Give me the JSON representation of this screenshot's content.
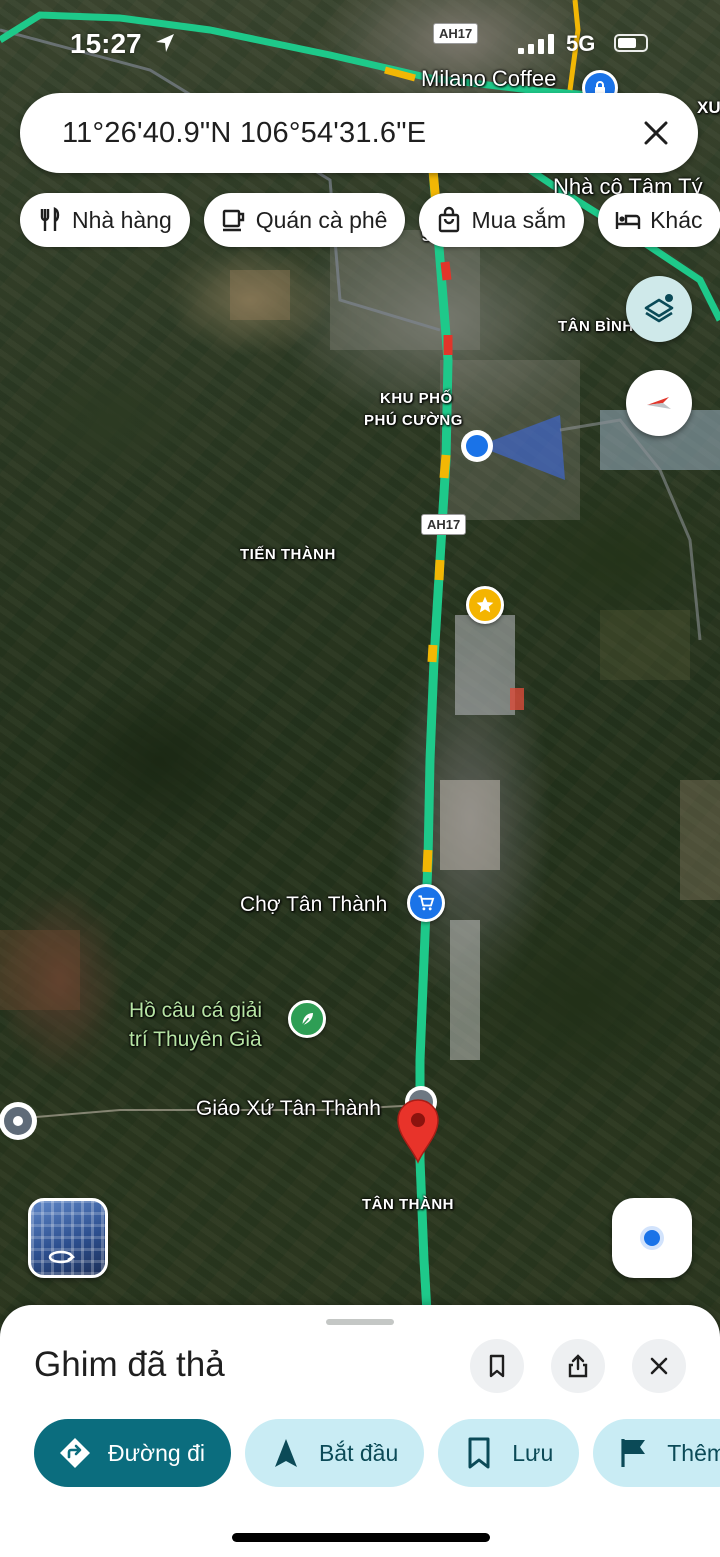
{
  "status_bar": {
    "time": "15:27",
    "network": "5G"
  },
  "search": {
    "query": "11°26'40.9\"N 106°54'31.6\"E"
  },
  "chips": [
    {
      "label": "Nhà hàng",
      "icon": "restaurant-icon"
    },
    {
      "label": "Quán cà phê",
      "icon": "coffee-icon"
    },
    {
      "label": "Mua sắm",
      "icon": "shopping-bag-icon"
    },
    {
      "label": "Khác",
      "icon": "hotel-bed-icon"
    }
  ],
  "map": {
    "labels": {
      "milano": "Milano Coffee",
      "xu": "XU",
      "nha_co": "Nhà cô Tâm Tý",
      "tan_binh": "TÂN BÌNH",
      "khu_pho_line1": "KHU PHỐ",
      "khu_pho_line2": "PHÚ CƯỜNG",
      "tien_thanh": "TIẾN THÀNH",
      "cho_tan_thanh": "Chợ Tân Thành",
      "ho_cau_line1": "Hồ câu cá giải",
      "ho_cau_line2": "trí Thuyên Già",
      "giao_xu": "Giáo Xứ Tân Thành",
      "tan_thanh": "TÂN THÀNH",
      "chu_g": "g"
    },
    "route_shields": [
      "AH17",
      "AH17"
    ],
    "colors": {
      "road_traffic_green": "#1ec98a",
      "road_traffic_yellow": "#f2b705",
      "road_traffic_red": "#e1352a",
      "user_location": "#1a73e8",
      "dropped_pin": "#e8332a",
      "star_poi": "#f4b400",
      "shopping_poi": "#1a73e8",
      "park_poi": "#2e9e55"
    }
  },
  "sheet": {
    "title": "Ghim đã thả",
    "actions": [
      {
        "label": "Đường đi",
        "icon": "directions-icon"
      },
      {
        "label": "Bắt đầu",
        "icon": "navigation-arrow-icon"
      },
      {
        "label": "Lưu",
        "icon": "bookmark-icon"
      },
      {
        "label": "Thêm",
        "icon": "flag-icon"
      }
    ]
  }
}
